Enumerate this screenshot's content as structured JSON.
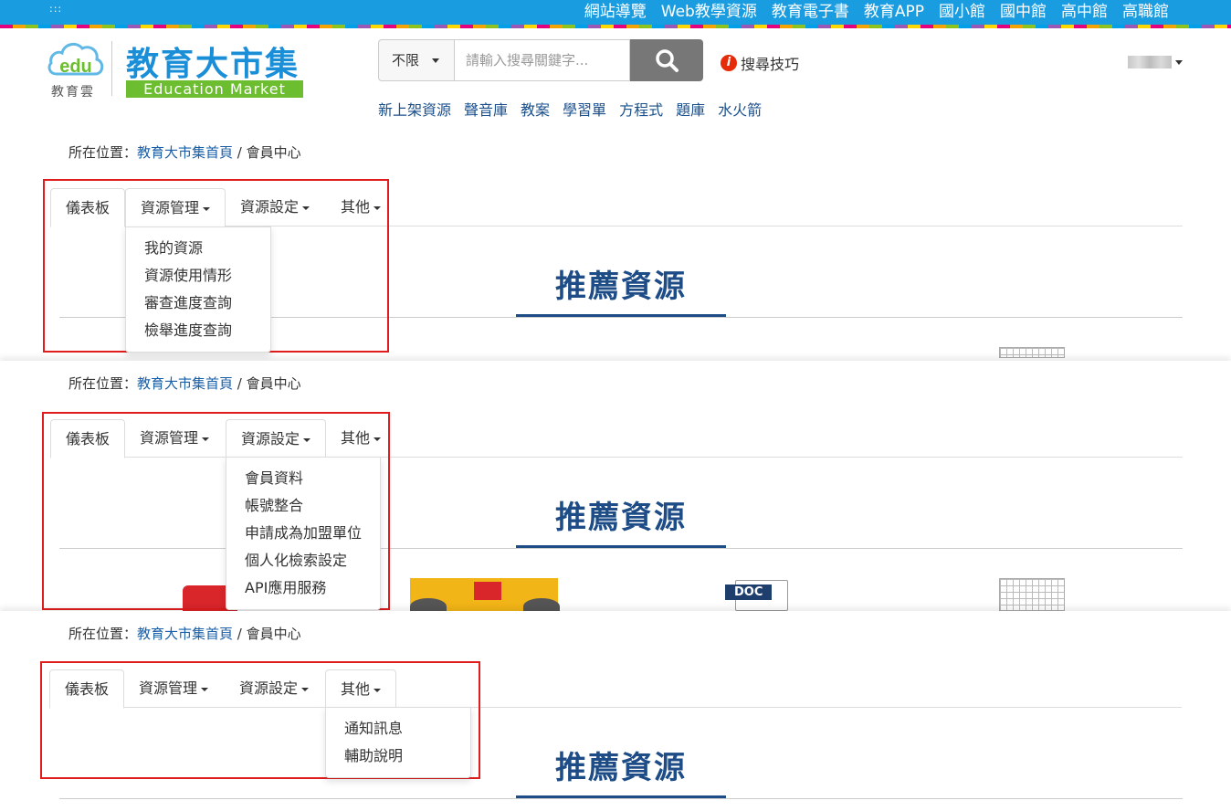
{
  "topbar": {
    "dots": ":::",
    "links": [
      "網站導覽",
      "Web教學資源",
      "教育電子書",
      "教育APP",
      "國小館",
      "國中館",
      "高中館",
      "高職館"
    ]
  },
  "header": {
    "edu_logo_text": "edu",
    "edu_logo_sub": "教育雲",
    "title": "教育大市集",
    "subtitle": "Education Market",
    "search": {
      "scope": "不限",
      "placeholder": "請輸入搜尋關鍵字..."
    },
    "tips": "搜尋技巧",
    "quick_links": [
      "新上架資源",
      "聲音庫",
      "教案",
      "學習單",
      "方程式",
      "題庫",
      "水火箭"
    ]
  },
  "breadcrumb": {
    "prefix": "所在位置：",
    "home": "教育大市集首頁",
    "separator": " / ",
    "current": "會員中心"
  },
  "tabs": {
    "dashboard": "儀表板",
    "resource_mgmt": "資源管理",
    "resource_settings": "資源設定",
    "other": "其他"
  },
  "menus": {
    "resource_mgmt": [
      "我的資源",
      "資源使用情形",
      "審查進度查詢",
      "檢舉進度查詢"
    ],
    "resource_settings": [
      "會員資料",
      "帳號整合",
      "申請成為加盟單位",
      "個人化檢索設定",
      "API應用服務"
    ],
    "other": [
      "通知訊息",
      "輔助說明"
    ]
  },
  "recommend_title": "推薦資源",
  "doc_badge": "DOC",
  "colors": {
    "topbar": "#1a9de0",
    "brand_blue": "#1a8fd8",
    "brand_green": "#6cbd2f",
    "title_navy": "#1e4c86",
    "highlight_red": "#e01c1c"
  }
}
